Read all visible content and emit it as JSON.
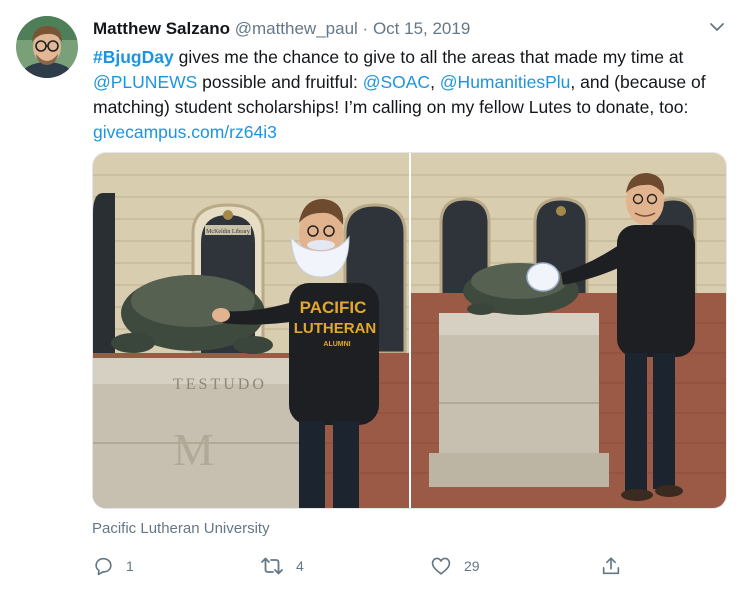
{
  "tweet": {
    "author_name": "Matthew Salzano",
    "author_handle": "@matthew_paul",
    "separator": "·",
    "date": "Oct 15, 2019",
    "hashtag": "#BjugDay",
    "text_1": " gives me the chance to give to all the areas that made my time at ",
    "mention_1": "@PLUNEWS",
    "text_2": " possible and fruitful: ",
    "mention_2": "@SOAC",
    "text_3": ", ",
    "mention_3": "@HumanitiesPlu",
    "text_4": ", and (because of matching) student scholarships! I’m calling on my fellow Lutes to donate, too: ",
    "link": "givecampus.com/rz64i3",
    "location": "Pacific Lutheran University",
    "photo_text": {
      "hoodie_line_1": "PACIFIC",
      "hoodie_line_2": "LUTHERAN",
      "hoodie_line_3": "ALUMNI",
      "plaque": "TESTUDO",
      "pedestal_letter": "M",
      "building_sign": "McKeldin Library"
    }
  },
  "actions": {
    "reply_count": "1",
    "retweet_count": "4",
    "like_count": "29"
  },
  "icons": {
    "caret": "chevron-down-icon",
    "reply": "reply-icon",
    "retweet": "retweet-icon",
    "like": "heart-icon",
    "share": "share-icon"
  },
  "colors": {
    "link": "#1b95e0",
    "secondary_text": "#657786",
    "primary_text": "#14171a"
  }
}
